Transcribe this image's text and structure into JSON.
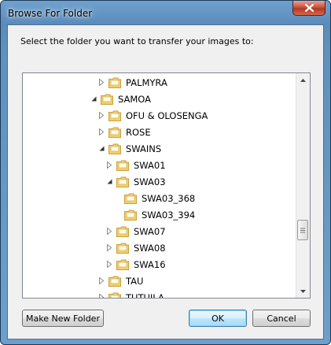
{
  "window": {
    "title": "Browse For Folder"
  },
  "instruction": "Select the folder you want to transfer your images to:",
  "tree": {
    "items": [
      {
        "label": "PALMYRA",
        "expanded": false
      },
      {
        "label": "SAMOA",
        "expanded": true
      },
      {
        "label": "OFU & OLOSENGA",
        "expanded": false
      },
      {
        "label": "ROSE",
        "expanded": false
      },
      {
        "label": "SWAINS",
        "expanded": true
      },
      {
        "label": "SWA01",
        "expanded": false
      },
      {
        "label": "SWA03",
        "expanded": true
      },
      {
        "label": "SWA03_368",
        "expanded": null
      },
      {
        "label": "SWA03_394",
        "expanded": null
      },
      {
        "label": "SWA07",
        "expanded": false
      },
      {
        "label": "SWA08",
        "expanded": false
      },
      {
        "label": "SWA16",
        "expanded": false
      },
      {
        "label": "TAU",
        "expanded": false
      },
      {
        "label": "TUTUILA",
        "expanded": false
      }
    ]
  },
  "buttons": {
    "make_new_folder": "Make New Folder",
    "ok": "OK",
    "cancel": "Cancel"
  },
  "icons": {
    "close": "close-icon",
    "folder": "folder-icon",
    "scroll_up": "scroll-up-icon",
    "scroll_down": "scroll-down-icon"
  },
  "colors": {
    "close_red": "#c9553f",
    "folder_yellow": "#f2cf6b",
    "titlebar_blue": "#5a8bbb"
  }
}
